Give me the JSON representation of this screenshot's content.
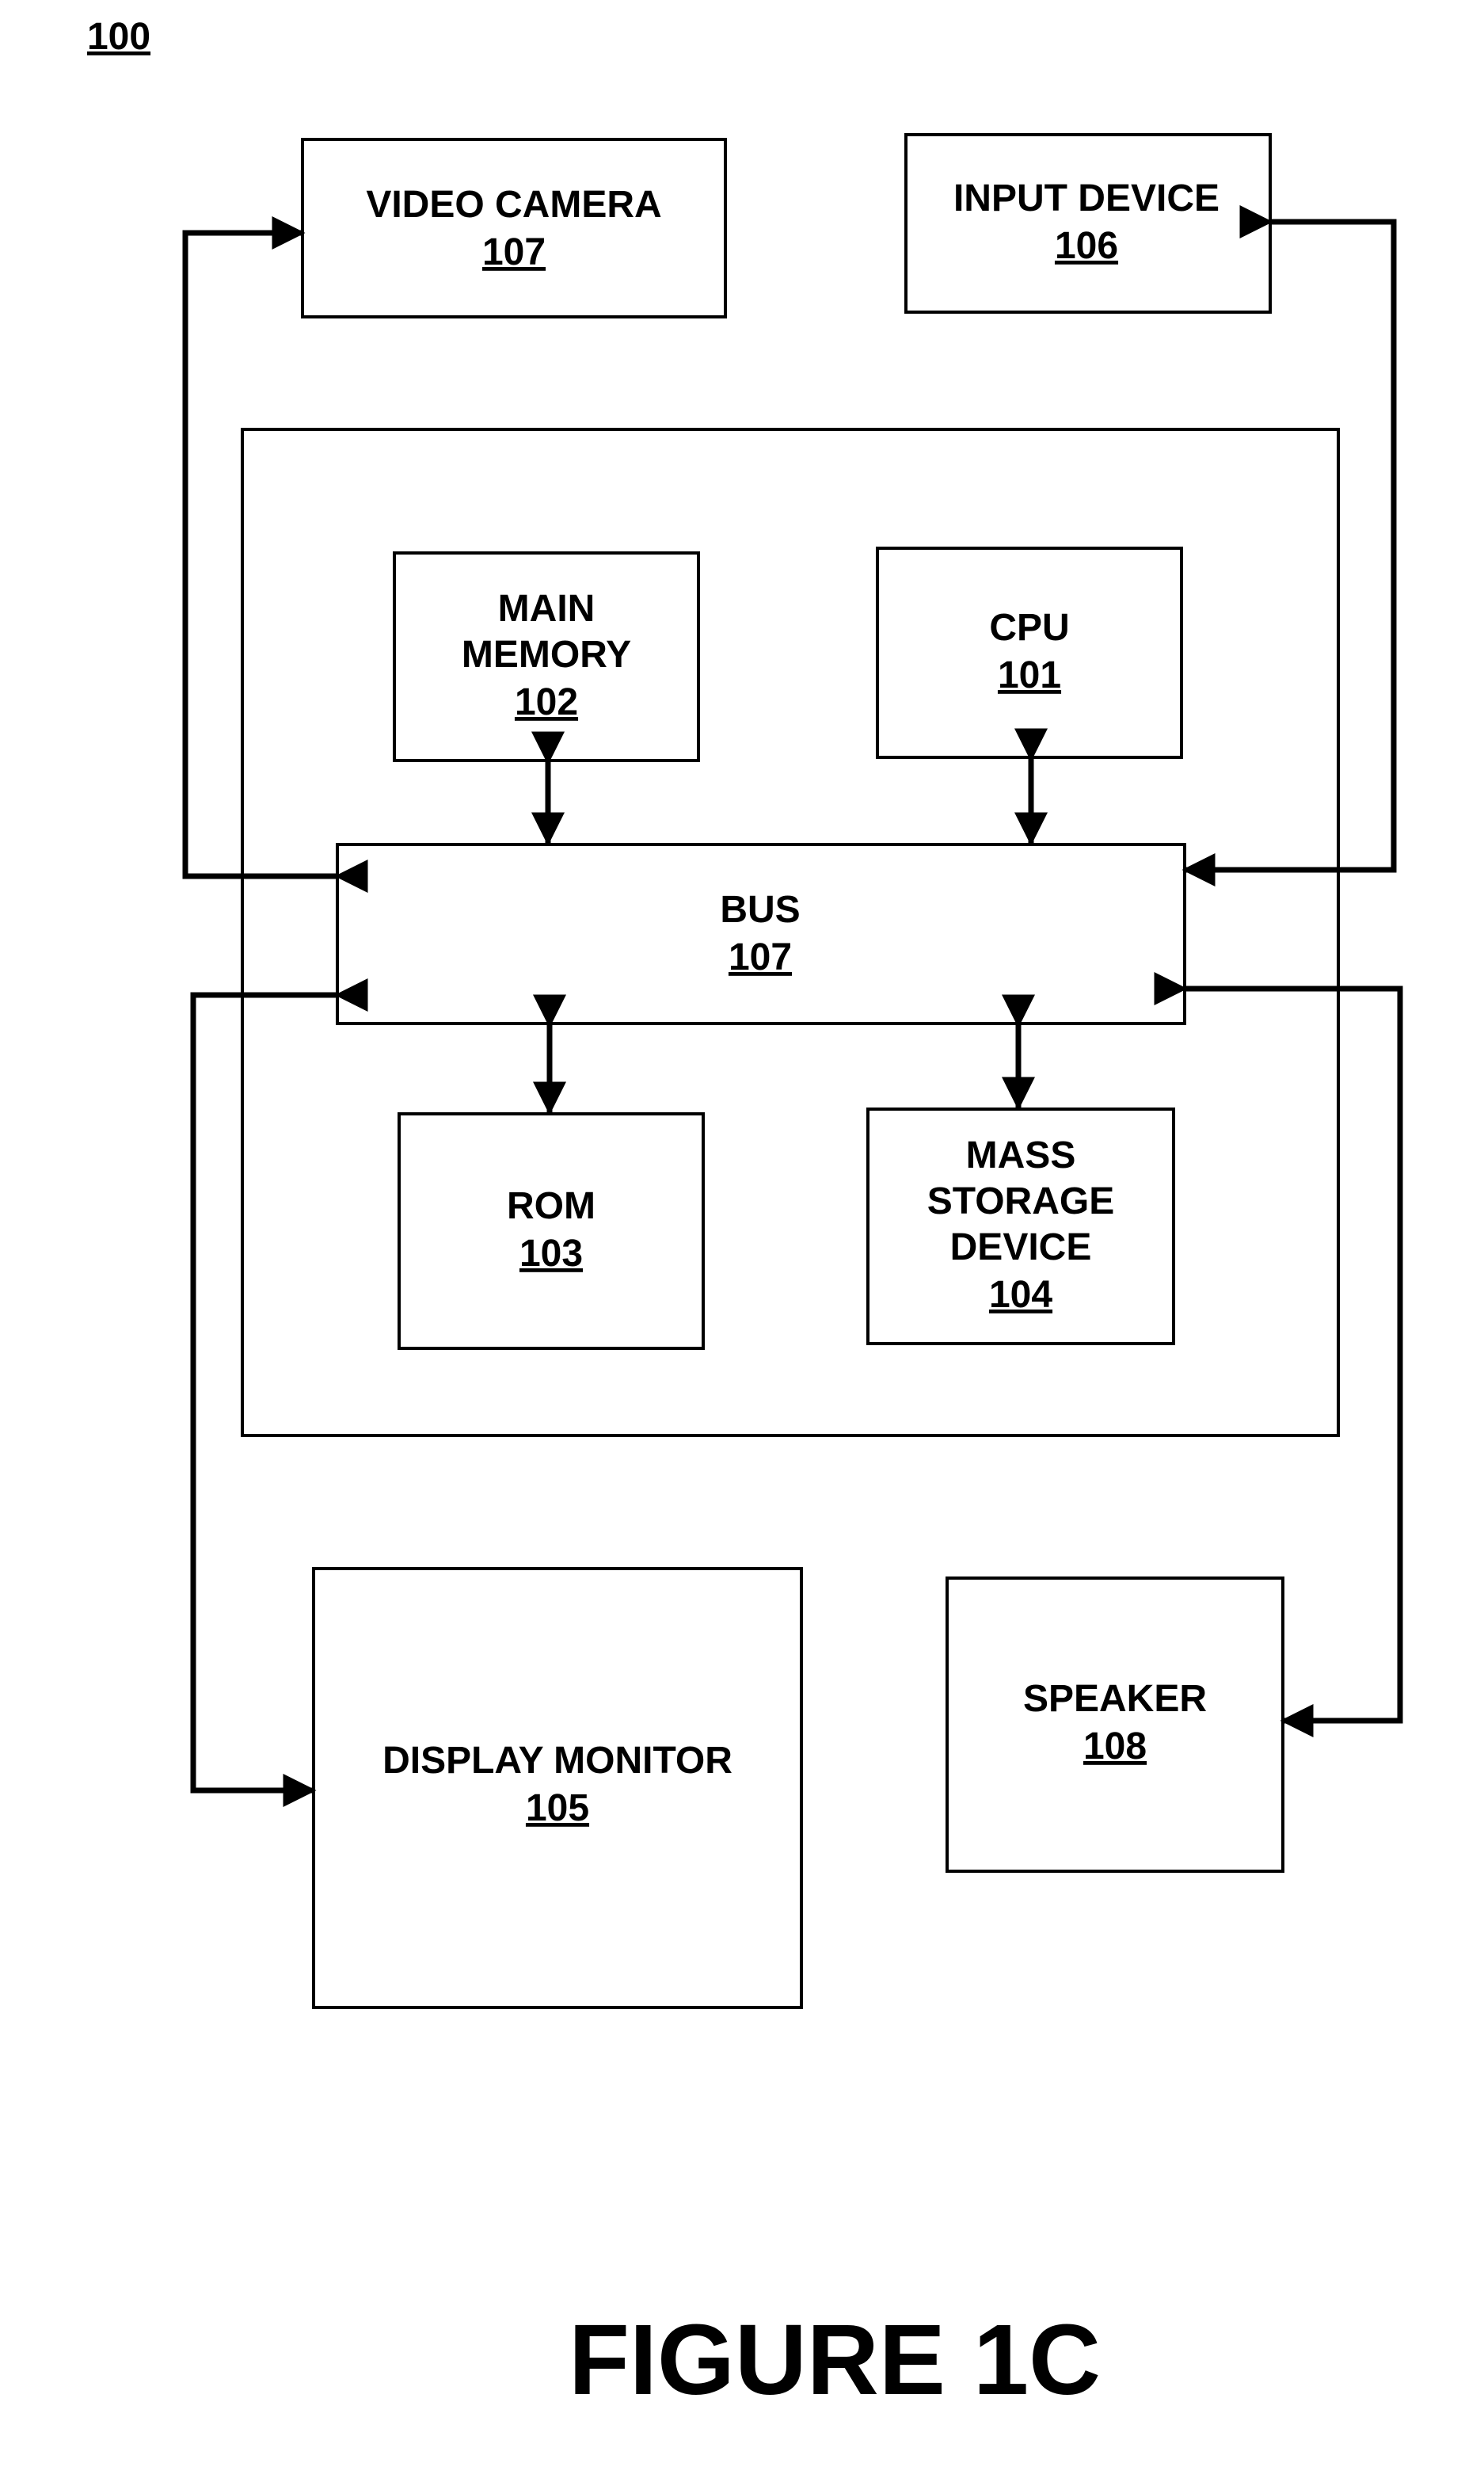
{
  "figure": {
    "ref": "100",
    "caption": "FIGURE 1C"
  },
  "colors": {
    "stroke": "#000000",
    "background": "#ffffff"
  },
  "blocks": {
    "video_camera": {
      "lines": [
        "VIDEO CAMERA"
      ],
      "ref": "107"
    },
    "input_device": {
      "lines": [
        "INPUT DEVICE"
      ],
      "ref": "106"
    },
    "main_memory": {
      "lines": [
        "MAIN",
        "MEMORY"
      ],
      "ref": "102"
    },
    "cpu": {
      "lines": [
        "CPU"
      ],
      "ref": "101"
    },
    "bus": {
      "lines": [
        "BUS"
      ],
      "ref": "107"
    },
    "rom": {
      "lines": [
        "ROM"
      ],
      "ref": "103"
    },
    "mass_storage": {
      "lines": [
        "MASS",
        "STORAGE",
        "DEVICE"
      ],
      "ref": "104"
    },
    "display_monitor": {
      "lines": [
        "DISPLAY MONITOR"
      ],
      "ref": "105"
    },
    "speaker": {
      "lines": [
        "SPEAKER"
      ],
      "ref": "108"
    }
  },
  "connections": [
    {
      "from": "bus",
      "to": "video_camera",
      "direction": "bidirectional"
    },
    {
      "from": "input_device",
      "to": "bus",
      "direction": "bidirectional"
    },
    {
      "from": "main_memory",
      "to": "bus",
      "direction": "bidirectional"
    },
    {
      "from": "cpu",
      "to": "bus",
      "direction": "bidirectional"
    },
    {
      "from": "bus",
      "to": "rom",
      "direction": "bidirectional"
    },
    {
      "from": "bus",
      "to": "mass_storage",
      "direction": "bidirectional"
    },
    {
      "from": "bus",
      "to": "display_monitor",
      "direction": "bidirectional"
    },
    {
      "from": "bus",
      "to": "speaker",
      "direction": "bidirectional"
    }
  ]
}
